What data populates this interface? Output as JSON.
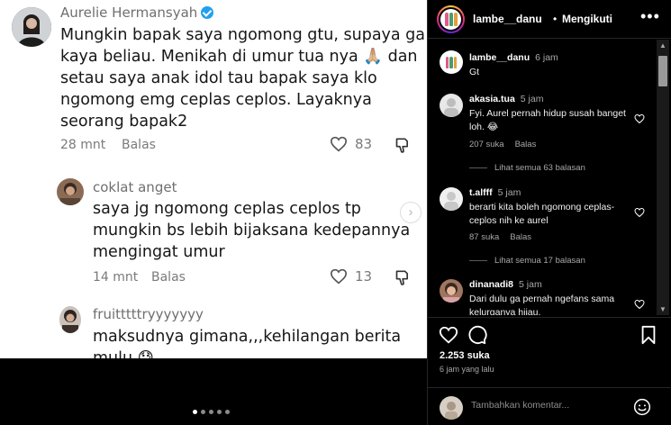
{
  "screenshot": {
    "comment1": {
      "name": "Aurelie Hermansyah",
      "body": [
        "Mungkin bapak saya ngomong gtu, supaya ga",
        "kaya beliau. Menikah di umur tua nya 🙏🏼 dan",
        "setau saya anak idol tau bapak saya klo",
        "ngomong emg ceplas ceplos. Layaknya",
        "seorang bapak2"
      ],
      "time": "28 mnt",
      "reply": "Balas",
      "likes": "83"
    },
    "comment2": {
      "name": "coklat anget",
      "body": [
        "saya jg ngomong ceplas ceplos tp",
        "mungkin bs lebih bijaksana kedepannya",
        "mengingat umur"
      ],
      "time": "14 mnt",
      "reply": "Balas",
      "likes": "13"
    },
    "comment3": {
      "name": "fruitttttryyyyyyy",
      "body": [
        "maksudnya gimana,,,kehilangan berita",
        "mulu 😓"
      ]
    }
  },
  "header": {
    "username": "lambe__danu",
    "separator": "•",
    "follow_status": "Mengikuti"
  },
  "caption": {
    "username": "lambe__danu",
    "time": "6 jam",
    "text": "Gt"
  },
  "comments": [
    {
      "username": "akasia.tua",
      "time": "5 jam",
      "text": "Fyi. Aurel pernah hidup susah banget loh. 😂",
      "likes": "207 suka",
      "reply": "Balas",
      "view_replies": "Lihat semua 63 balasan"
    },
    {
      "username": "t.alfff",
      "time": "5 jam",
      "text": "berarti kita boleh ngomong ceplas-ceplos nih ke aurel",
      "likes": "87 suka",
      "reply": "Balas",
      "view_replies": "Lihat semua 17 balasan"
    },
    {
      "username": "dinanadi8",
      "time": "5 jam",
      "text": "Dari dulu ga pernah ngefans sama kelurganya hijau."
    }
  ],
  "stats": {
    "likes": "2.253 suka",
    "posted": "6 jam yang lalu"
  },
  "composer": {
    "placeholder": "Tambahkan komentar..."
  },
  "colors": {
    "background": "#000000",
    "verified": "#20a0f0",
    "secondary_text": "#a8a8a8"
  },
  "icons": [
    "more-icon",
    "heart-icon",
    "comment-icon",
    "bookmark-icon",
    "emoji-icon",
    "chevron-right-icon",
    "thumbs-down-icon",
    "verified-icon"
  ]
}
